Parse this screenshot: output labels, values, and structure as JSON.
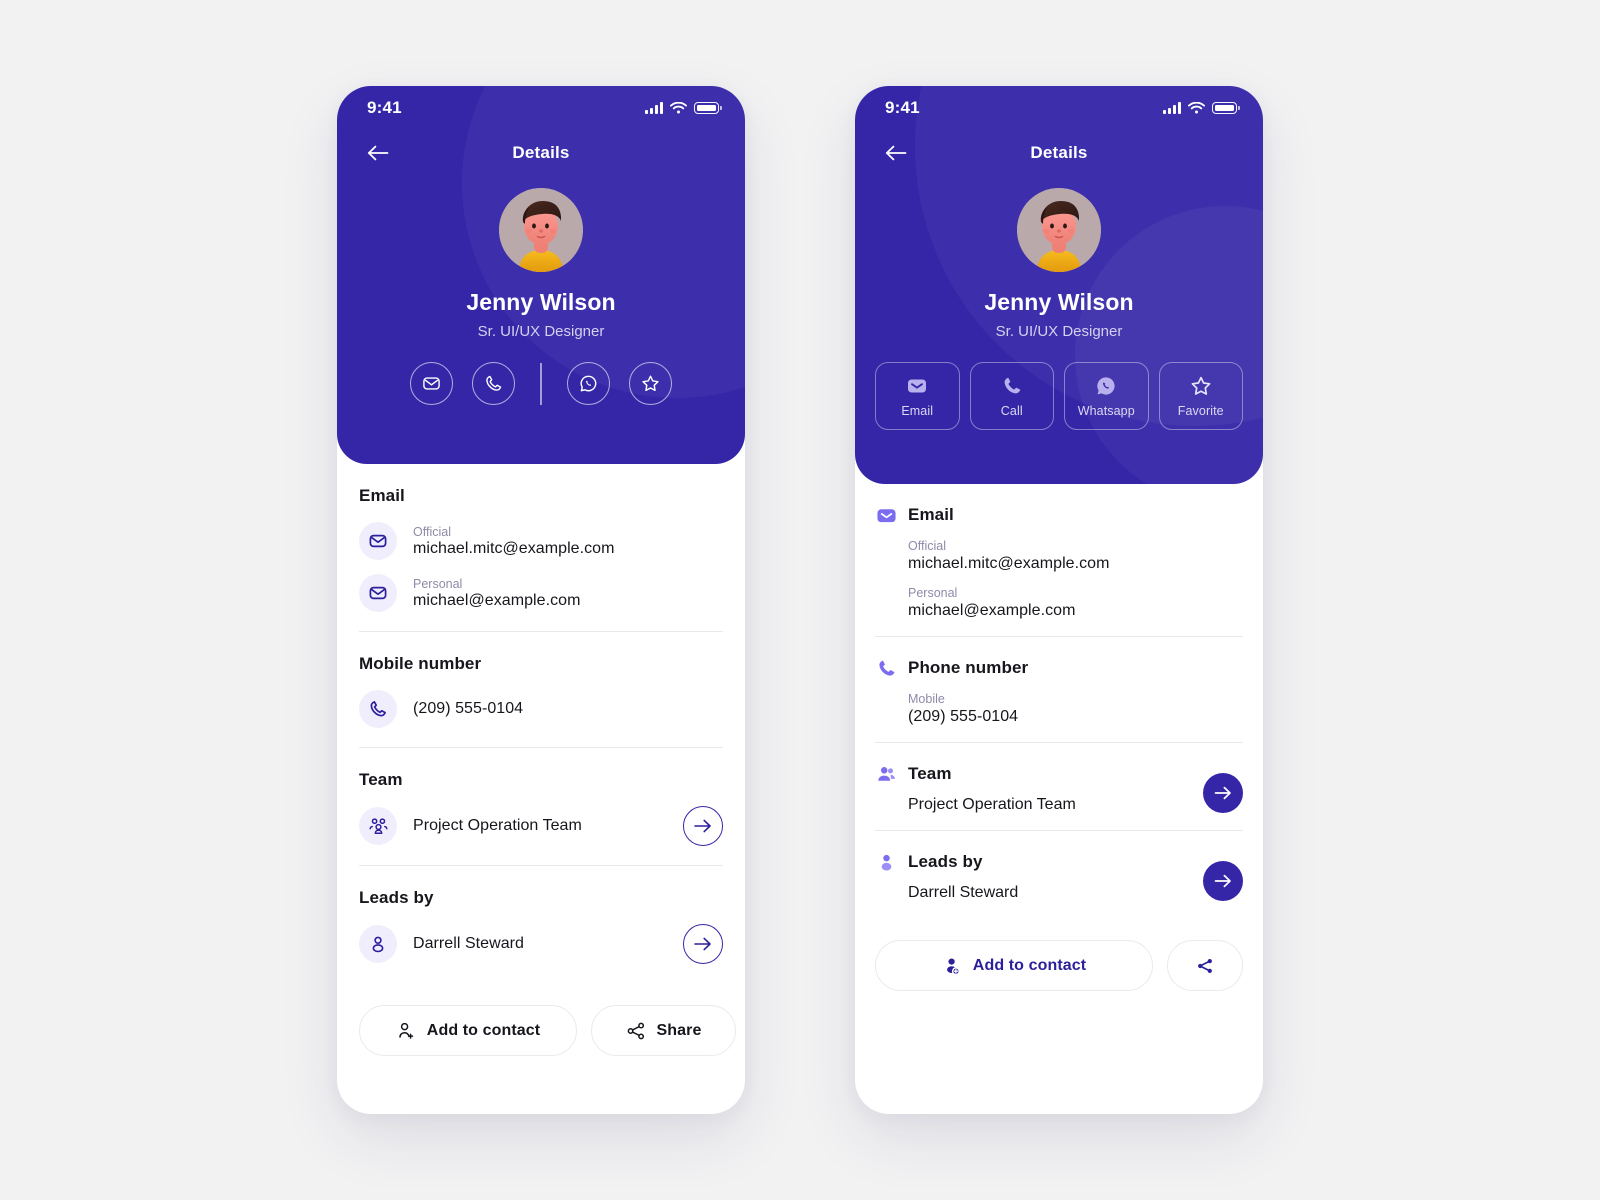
{
  "theme": {
    "background": "#f2f2f3",
    "primary": "#3526a8",
    "primary_deep": "#2c1f9c",
    "accent_light": "#7c6df0",
    "badge_bg": "#f0eefc",
    "muted_text": "#8e8ba8",
    "body_text": "#17161c",
    "hero_subtext": "#d5d0ef"
  },
  "status_bar": {
    "time": "9:41",
    "signal_icon": "signal-bars-icon",
    "wifi_icon": "wifi-icon",
    "battery_icon": "battery-icon"
  },
  "screen_a": {
    "nav": {
      "back_icon": "back-arrow-icon",
      "title": "Details"
    },
    "profile": {
      "avatar_icon": "avatar-3d-illustration",
      "name": "Jenny Wilson",
      "role": "Sr. UI/UX Designer"
    },
    "quick_actions": [
      {
        "icon": "email-icon",
        "name": "email"
      },
      {
        "icon": "phone-icon",
        "name": "call"
      },
      {
        "divider": true
      },
      {
        "icon": "whatsapp-icon",
        "name": "whatsapp"
      },
      {
        "icon": "star-icon",
        "name": "favorite"
      }
    ],
    "sections": [
      {
        "title": "Email",
        "rows": [
          {
            "icon": "email-icon",
            "kicker": "Official",
            "value": "michael.mitc@example.com"
          },
          {
            "icon": "email-icon",
            "kicker": "Personal",
            "value": "michael@example.com"
          }
        ]
      },
      {
        "title": "Mobile number",
        "rows": [
          {
            "icon": "phone-icon",
            "kicker": "",
            "value": "(209) 555-0104"
          }
        ]
      },
      {
        "title": "Team",
        "rows": [
          {
            "icon": "team-icon",
            "kicker": "",
            "value": "Project Operation Team",
            "arrow": true
          }
        ]
      },
      {
        "title": "Leads by",
        "rows": [
          {
            "icon": "person-icon",
            "kicker": "",
            "value": "Darrell Steward",
            "arrow": true
          }
        ]
      }
    ],
    "footer": {
      "add_label": "Add to contact",
      "add_icon": "add-person-icon",
      "share_label": "Share",
      "share_icon": "share-icon"
    }
  },
  "screen_b": {
    "nav": {
      "back_icon": "back-arrow-icon",
      "title": "Details"
    },
    "profile": {
      "avatar_icon": "avatar-3d-illustration",
      "name": "Jenny Wilson",
      "role": "Sr. UI/UX Designer"
    },
    "quick_actions": [
      {
        "icon": "email-icon",
        "label": "Email"
      },
      {
        "icon": "phone-icon",
        "label": "Call"
      },
      {
        "icon": "whatsapp-icon",
        "label": "Whatsapp"
      },
      {
        "icon": "star-icon",
        "label": "Favorite"
      }
    ],
    "sections": [
      {
        "title": "Email",
        "icon": "email-icon",
        "fields": [
          {
            "kicker": "Official",
            "value": "michael.mitc@example.com"
          },
          {
            "kicker": "Personal",
            "value": "michael@example.com"
          }
        ]
      },
      {
        "title": "Phone number",
        "icon": "phone-icon",
        "fields": [
          {
            "kicker": "Mobile",
            "value": "(209) 555-0104"
          }
        ]
      },
      {
        "title": "Team",
        "icon": "team-icon",
        "sub": "Project Operation Team",
        "arrow": true
      },
      {
        "title": "Leads by",
        "icon": "person-icon",
        "sub": "Darrell Steward",
        "arrow": true
      }
    ],
    "footer": {
      "add_label": "Add to contact",
      "add_icon": "add-person-icon",
      "share_icon": "share-icon"
    }
  }
}
